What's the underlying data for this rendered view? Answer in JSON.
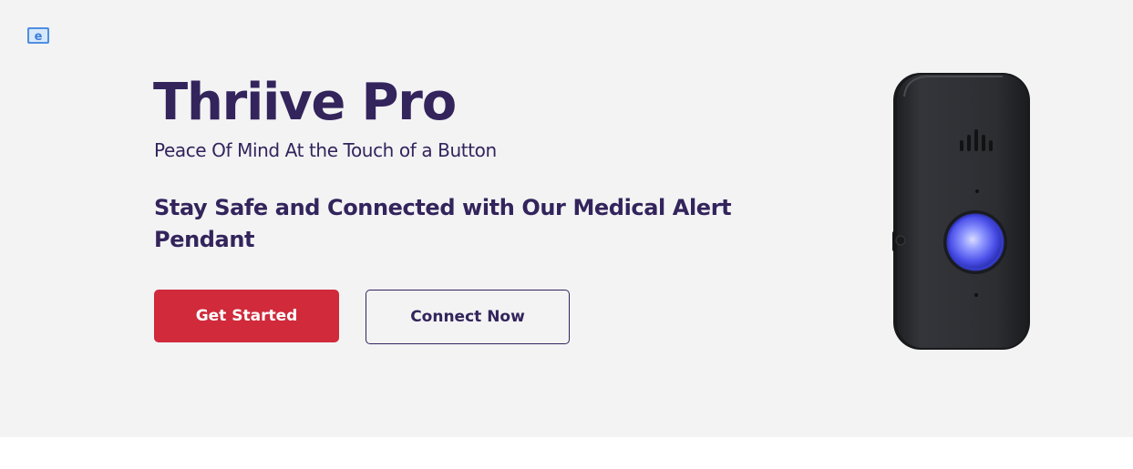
{
  "brand": {
    "logo_icon": "e-logo-icon",
    "logo_color": "#4f8fe0"
  },
  "hero": {
    "title": "Thriive Pro",
    "subtitle": "Peace Of Mind At the Touch of a Button",
    "tagline": "Stay Safe and Connected with Our Medical Alert Pendant",
    "product_image": "medical-alert-pendant-device"
  },
  "actions": {
    "primary_label": "Get Started",
    "secondary_label": "Connect Now"
  },
  "colors": {
    "heading": "#33245c",
    "primary_button": "#d02a3b",
    "hero_background": "#f3f3f4",
    "device_body": "#2f3033",
    "device_button_glow": "#5c63ff"
  }
}
